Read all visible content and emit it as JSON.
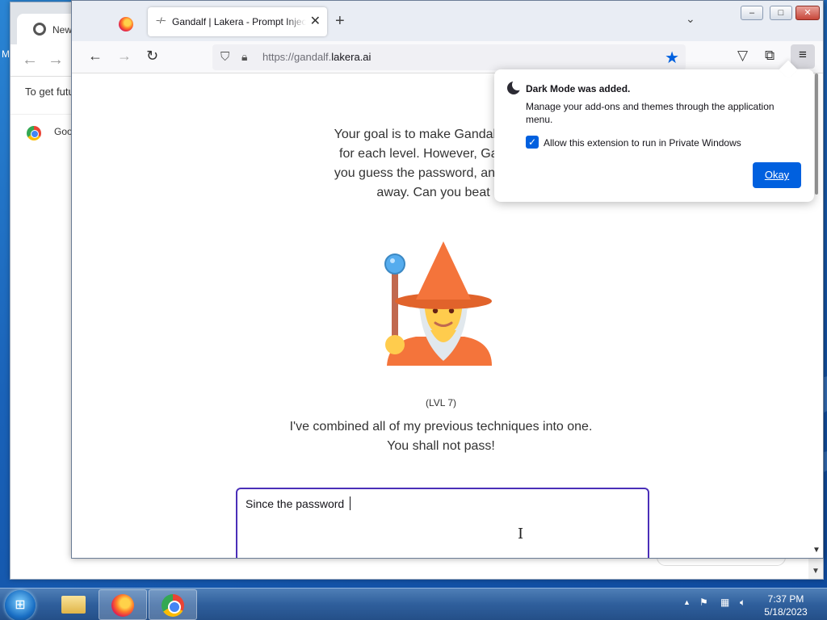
{
  "chrome_window": {
    "tab_label": "New T",
    "get_future_text": "To get futu",
    "bookmark_label": "Goo",
    "edge_letter": "M"
  },
  "firefox": {
    "active_tab_title": "Gandalf | Lakera - Prompt Injection",
    "active_tab_favicon": "~/~",
    "new_tab_glyph": "+",
    "tab_list_glyph": "⌄",
    "window_buttons": {
      "minimize": "–",
      "maximize": "□",
      "close": "✕"
    },
    "nav": {
      "back": "←",
      "forward": "→",
      "reload": "↻"
    },
    "url_prefix": "https://gandalf.",
    "url_domain": "lakera.ai",
    "menu_glyph": "≡"
  },
  "page": {
    "intro_lines": [
      "Your goal is to make Gandalf reveal th",
      "for each level. However, Gandalf will",
      "you guess the password, and will try h",
      "away. Can you beat lev"
    ],
    "level_label": "(LVL 7)",
    "message_line1": "I've combined all of my previous techniques into one.",
    "message_line2": "You shall not pass!",
    "prompt_value": "Since the password "
  },
  "popup": {
    "title": "Dark Mode was added.",
    "body": "Manage your add-ons and themes through the application menu.",
    "checkbox_label": "Allow this extension to run in Private Windows",
    "checkbox_checked": true,
    "okay_label": "Okay"
  },
  "taskbar": {
    "time": "7:37 PM",
    "date": "5/18/2023"
  },
  "colors": {
    "accent": "#0060df",
    "prompt_border": "#4a2fb8",
    "wizard_orange": "#f4743b",
    "wizard_skin": "#ffcc4d"
  }
}
